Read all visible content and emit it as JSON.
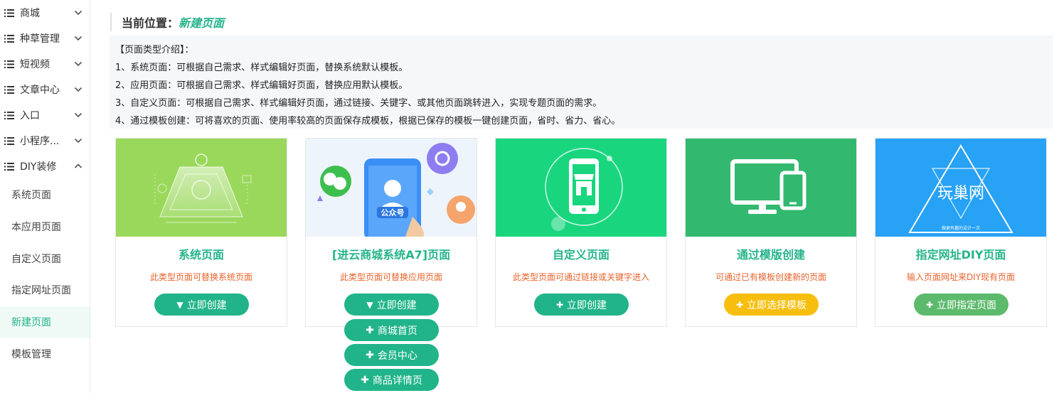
{
  "sidebar": {
    "groups": [
      {
        "label": "商城",
        "icon": "list-icon",
        "expanded": false
      },
      {
        "label": "种草管理",
        "icon": "list-icon",
        "expanded": false
      },
      {
        "label": "短视频",
        "icon": "list-icon",
        "expanded": false
      },
      {
        "label": "文章中心",
        "icon": "list-icon",
        "expanded": false
      },
      {
        "label": "入口",
        "icon": "list-icon",
        "expanded": false
      },
      {
        "label": "小程序...",
        "icon": "list-icon",
        "expanded": false
      },
      {
        "label": "DIY装修",
        "icon": "list-icon",
        "expanded": true
      }
    ],
    "sub_items": [
      {
        "label": "系统页面",
        "active": false
      },
      {
        "label": "本应用页面",
        "active": false
      },
      {
        "label": "自定义页面",
        "active": false
      },
      {
        "label": "指定网址页面",
        "active": false
      },
      {
        "label": "新建页面",
        "active": true
      },
      {
        "label": "模板管理",
        "active": false
      }
    ]
  },
  "location": {
    "label": "当前位置：",
    "value": "新建页面"
  },
  "intro": {
    "lines": [
      "【页面类型介绍】：",
      "1、系统页面：可根据自己需求、样式编辑好页面，替换系统默认模板。",
      "2、应用页面：可根据自己需求、样式编辑好页面，替换应用默认模板。",
      "3、自定义页面：可根据自己需求、样式编辑好页面，通过链接、关键字、或其他页面跳转进入，实现专题页面的需求。",
      "4、通过模板创建：可将喜欢的页面、使用率较高的页面保存成模板，根据已保存的模板一键创建页面，省时、省力、省心。"
    ]
  },
  "cards": [
    {
      "title": "系统页面",
      "desc": "此类型页面可替换系统页面",
      "button": "立即创建",
      "button_icon": "caret-down-icon",
      "button_color": "#21b48a",
      "banner_color": "#9ad85c"
    },
    {
      "title": "[进云商城系统A7]页面",
      "desc": "此类型页面可替换应用页面",
      "button": "立即创建",
      "button_icon": "caret-down-icon",
      "button_color": "#21b48a",
      "banner_color": "#e8f1fb",
      "banner_text": "公众号"
    },
    {
      "title": "自定义页面",
      "desc": "此类型页面可通过链接或关键字进入",
      "button": "立即创建",
      "button_icon": "plus-icon",
      "button_color": "#21b48a",
      "banner_color": "#19d67e"
    },
    {
      "title": "通过模版创建",
      "desc": "可通过已有模板创建新的页面",
      "button": "立即选择模板",
      "button_icon": "plus-icon",
      "button_color": "#f8be0e",
      "banner_color": "#33b870"
    },
    {
      "title": "指定网址DIY页面",
      "desc": "输入页面网址来DIY现有页面",
      "button": "立即指定页面",
      "button_icon": "plus-icon",
      "button_color": "#5dba6c",
      "banner_color": "#27a2f5",
      "banner_text": "玩巢网",
      "banner_subtext": "做更有趣的设计一次"
    }
  ],
  "dropdown": {
    "items": [
      {
        "label": "商城首页",
        "icon": "plus-icon"
      },
      {
        "label": "会员中心",
        "icon": "plus-icon"
      },
      {
        "label": "商品详情页",
        "icon": "plus-icon"
      }
    ]
  }
}
